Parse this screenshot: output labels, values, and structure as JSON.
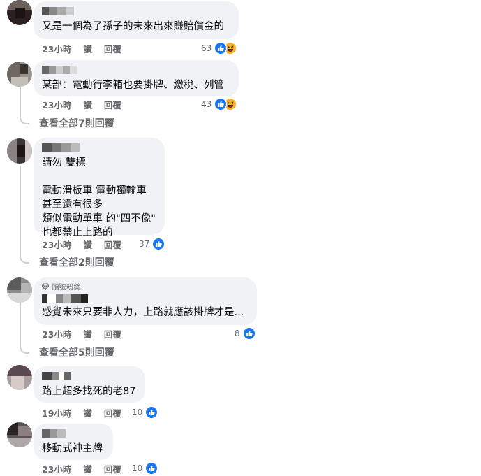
{
  "comments": [
    {
      "text": "又是一個為了孫子的未來出來賺賠償金的",
      "time": "23小時",
      "like_label": "讚",
      "reply_label": "回覆",
      "reaction_count": "63",
      "reactions": [
        "like-icon",
        "haha-icon"
      ]
    },
    {
      "text": "某部：電動行李箱也要掛牌、繳稅、列管",
      "time": "23小時",
      "like_label": "讚",
      "reply_label": "回覆",
      "reaction_count": "43",
      "reactions": [
        "like-icon",
        "haha-icon"
      ],
      "view_replies": "查看全部7則回覆"
    },
    {
      "text": "請勿 雙標\n\n電動滑板車 電動獨輪車\n甚至還有很多\n類似電動單車 的\"四不像\"\n也都禁止上路的",
      "time": "23小時",
      "like_label": "讚",
      "reply_label": "回覆",
      "reaction_count": "37",
      "reactions": [
        "like-icon"
      ],
      "view_replies": "查看全部2則回覆"
    },
    {
      "badge": "頭號粉絲",
      "text": "感覺未來只要非人力，上路就應該掛牌才是...",
      "time": "23小時",
      "like_label": "讚",
      "reply_label": "回覆",
      "reaction_count": "8",
      "reactions": [
        "like-icon"
      ],
      "view_replies": "查看全部5則回覆"
    },
    {
      "text": "路上超多找死的老87",
      "time": "19小時",
      "like_label": "讚",
      "reply_label": "回覆",
      "reaction_count": "10",
      "reactions": [
        "like-icon"
      ]
    },
    {
      "text": "移動式神主牌",
      "time": "23小時",
      "like_label": "讚",
      "reply_label": "回覆",
      "reaction_count": "10",
      "reactions": [
        "like-icon"
      ]
    }
  ],
  "colors": {
    "bubble": "#f0f2f5",
    "meta_text": "#65676b",
    "like_blue": "#1877f2",
    "haha_yellow": "#f7b125"
  }
}
